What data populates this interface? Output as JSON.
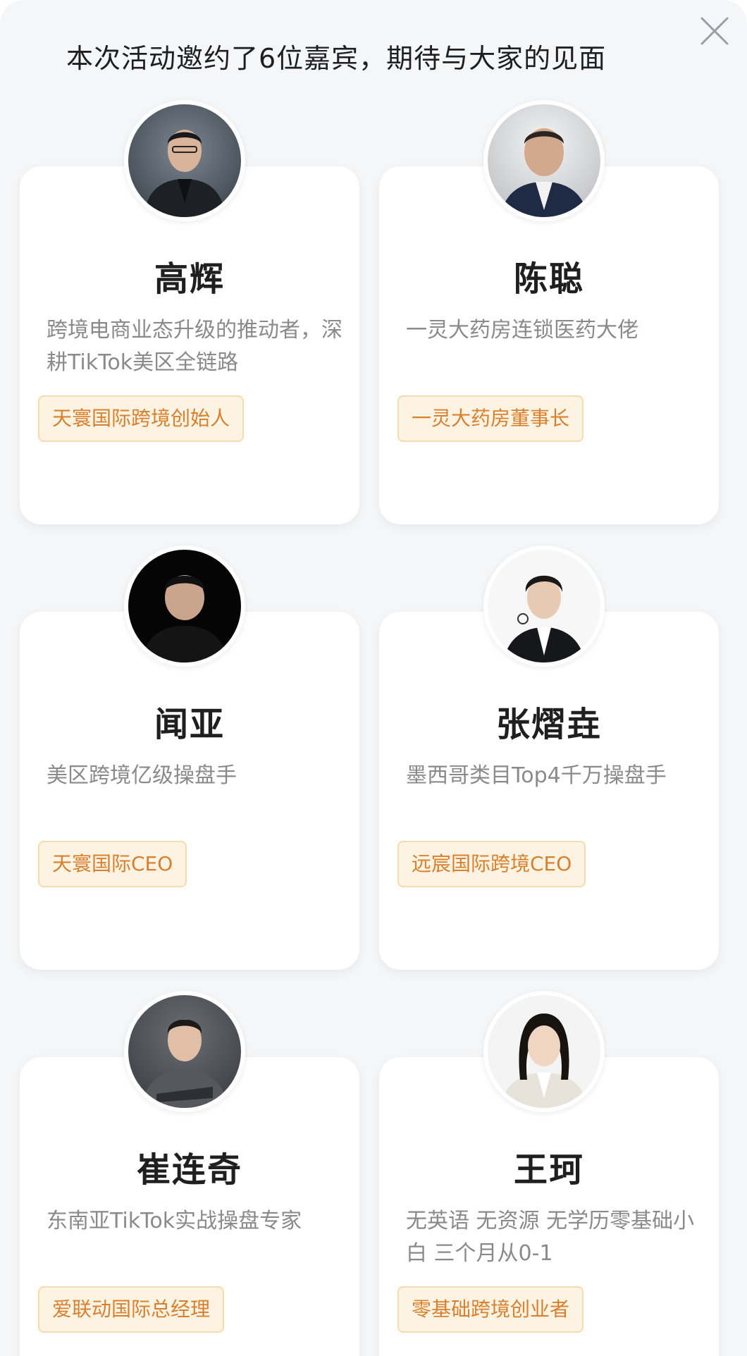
{
  "header": {
    "title": "本次活动邀约了6位嘉宾，期待与大家的见面"
  },
  "guests": [
    {
      "name": "高辉",
      "desc": "跨境电商业态升级的推动者，深耕TikTok美区全链路",
      "tag": "天寰国际跨境创始人",
      "avatar_icon": "guest-avatar-photo"
    },
    {
      "name": "陈聪",
      "desc": "一灵大药房连锁医药大佬",
      "tag": "一灵大药房董事长",
      "avatar_icon": "guest-avatar-photo"
    },
    {
      "name": "闻亚",
      "desc": "美区跨境亿级操盘手",
      "tag": "天寰国际CEO",
      "avatar_icon": "guest-avatar-photo"
    },
    {
      "name": "张熠垚",
      "desc": "墨西哥类目Top4千万操盘手",
      "tag": "远宸国际跨境CEO",
      "avatar_icon": "guest-avatar-photo"
    },
    {
      "name": "崔连奇",
      "desc": "东南亚TikTok实战操盘专家",
      "tag": "爱联动国际总经理",
      "avatar_icon": "guest-avatar-photo"
    },
    {
      "name": "王珂",
      "desc": "无英语 无资源 无学历零基础小白 三个月从0-1",
      "tag": "零基础跨境创业者",
      "avatar_icon": "guest-avatar-photo"
    }
  ],
  "colors": {
    "tag_text": "#d9802e",
    "tag_bg": "#fdf3e2",
    "tag_border": "#f5dcae",
    "page_bg": "#f5f6f8"
  },
  "icons": {
    "close": "close-icon"
  }
}
